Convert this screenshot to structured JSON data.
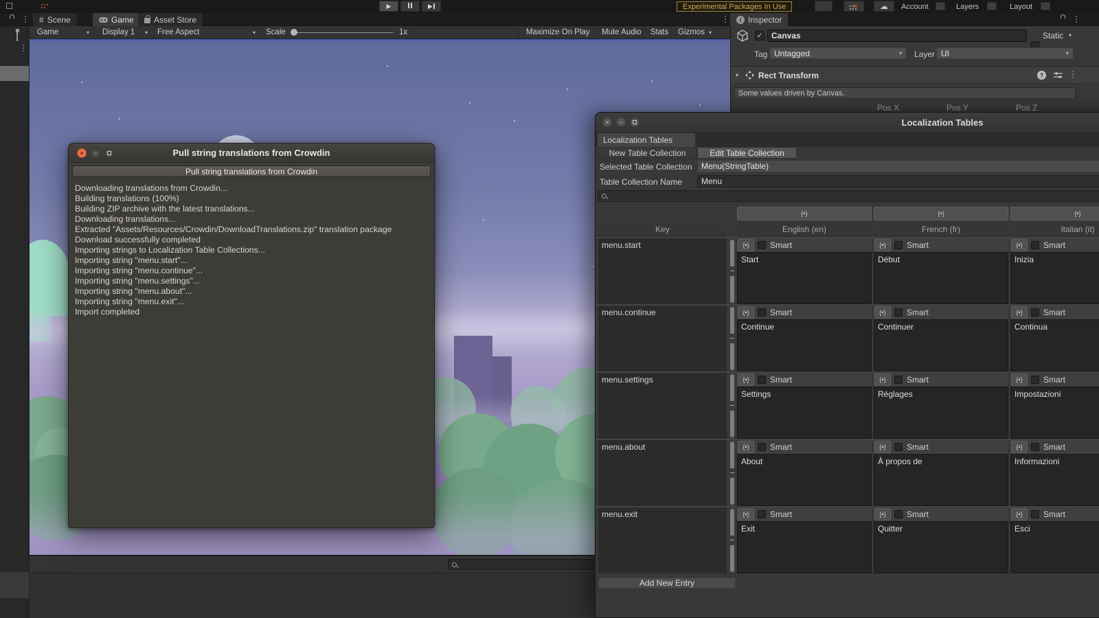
{
  "icons": {
    "dropdown": "▾",
    "fold": "▼",
    "kebab": "⋮",
    "hash": "#",
    "info": "i",
    "cloud": "☁",
    "play": "▶",
    "close": "×",
    "minimize": "−",
    "check": "✓",
    "braces": "{•}",
    "remove": "−",
    "help": "?"
  },
  "colors": {
    "warning_text": "#d5a94f",
    "close_button": "#ef7049",
    "sky_top": "#5e6a9c",
    "horizon": "#c3bcdb",
    "ground": "#8b7db0",
    "bush_green": "#79a98c",
    "accent_line": "#4656b8"
  },
  "top_toolbar": {
    "warning_badge": "Experimental Packages In Use",
    "account_label": "Account",
    "layers_label": "Layers",
    "layout_label": "Layout"
  },
  "tabs": {
    "scene": "Scene",
    "game": "Game",
    "asset_store": "Asset Store",
    "inspector": "Inspector"
  },
  "game_toolbar": {
    "game_dropdown": "Game",
    "display_dropdown": "Display 1",
    "aspect_dropdown": "Free Aspect",
    "scale_label": "Scale",
    "scale_value": "1x",
    "maximize_on_play": "Maximize On Play",
    "mute_audio": "Mute Audio",
    "stats": "Stats",
    "gizmos": "Gizmos"
  },
  "inspector": {
    "object_name": "Canvas",
    "static_label": "Static",
    "tag_label": "Tag",
    "tag_value": "Untagged",
    "layer_label": "Layer",
    "layer_value": "UI",
    "component_name": "Rect Transform",
    "driven_note": "Some values driven by Canvas.",
    "pos_x_label": "Pos X",
    "pos_y_label": "Pos Y",
    "pos_z_label": "Pos Z"
  },
  "crowdin_dialog": {
    "title": "Pull string translations from Crowdin",
    "action_button": "Pull string translations from Crowdin",
    "log_lines": [
      "Downloading translations from Crowdin...",
      "Building translations (100%)",
      "Building ZIP archive with the latest translations...",
      "Downloading translations...",
      "Extracted \"Assets/Resources/Crowdin/DownloadTranslations.zip\" translation package",
      "Download successfully completed",
      "Importing strings to Localization Table Collections...",
      "Importing string \"menu.start\"...",
      "Importing string \"menu.continue\"...",
      "Importing string \"menu.settings\"...",
      "Importing string \"menu.about\"...",
      "Importing string \"menu.exit\"...",
      "Import completed"
    ]
  },
  "localization_window": {
    "title": "Localization Tables",
    "tab": "Localization Tables",
    "new_table_button": "New Table Collection",
    "edit_table_button": "Edit Table Collection",
    "selected_table_label": "Selected Table Collection",
    "selected_table_value": "Menu(StringTable)",
    "name_label": "Table Collection Name",
    "name_value": "Menu",
    "key_column": "Key",
    "language_columns": [
      "English (en)",
      "French (fr)",
      "Italian (it)"
    ],
    "smart_label": "Smart",
    "add_entry_button": "Add New Entry",
    "rows": [
      {
        "key": "menu.start",
        "en": "Start",
        "fr": "Début",
        "it": "Inizia"
      },
      {
        "key": "menu.continue",
        "en": "Continue",
        "fr": "Continuer",
        "it": "Continua"
      },
      {
        "key": "menu.settings",
        "en": "Settings",
        "fr": "Réglages",
        "it": "Impostazioni"
      },
      {
        "key": "menu.about",
        "en": "About",
        "fr": "À propos de",
        "it": "Informazioni"
      },
      {
        "key": "menu.exit",
        "en": "Exit",
        "fr": "Quitter",
        "it": "Esci"
      }
    ]
  }
}
